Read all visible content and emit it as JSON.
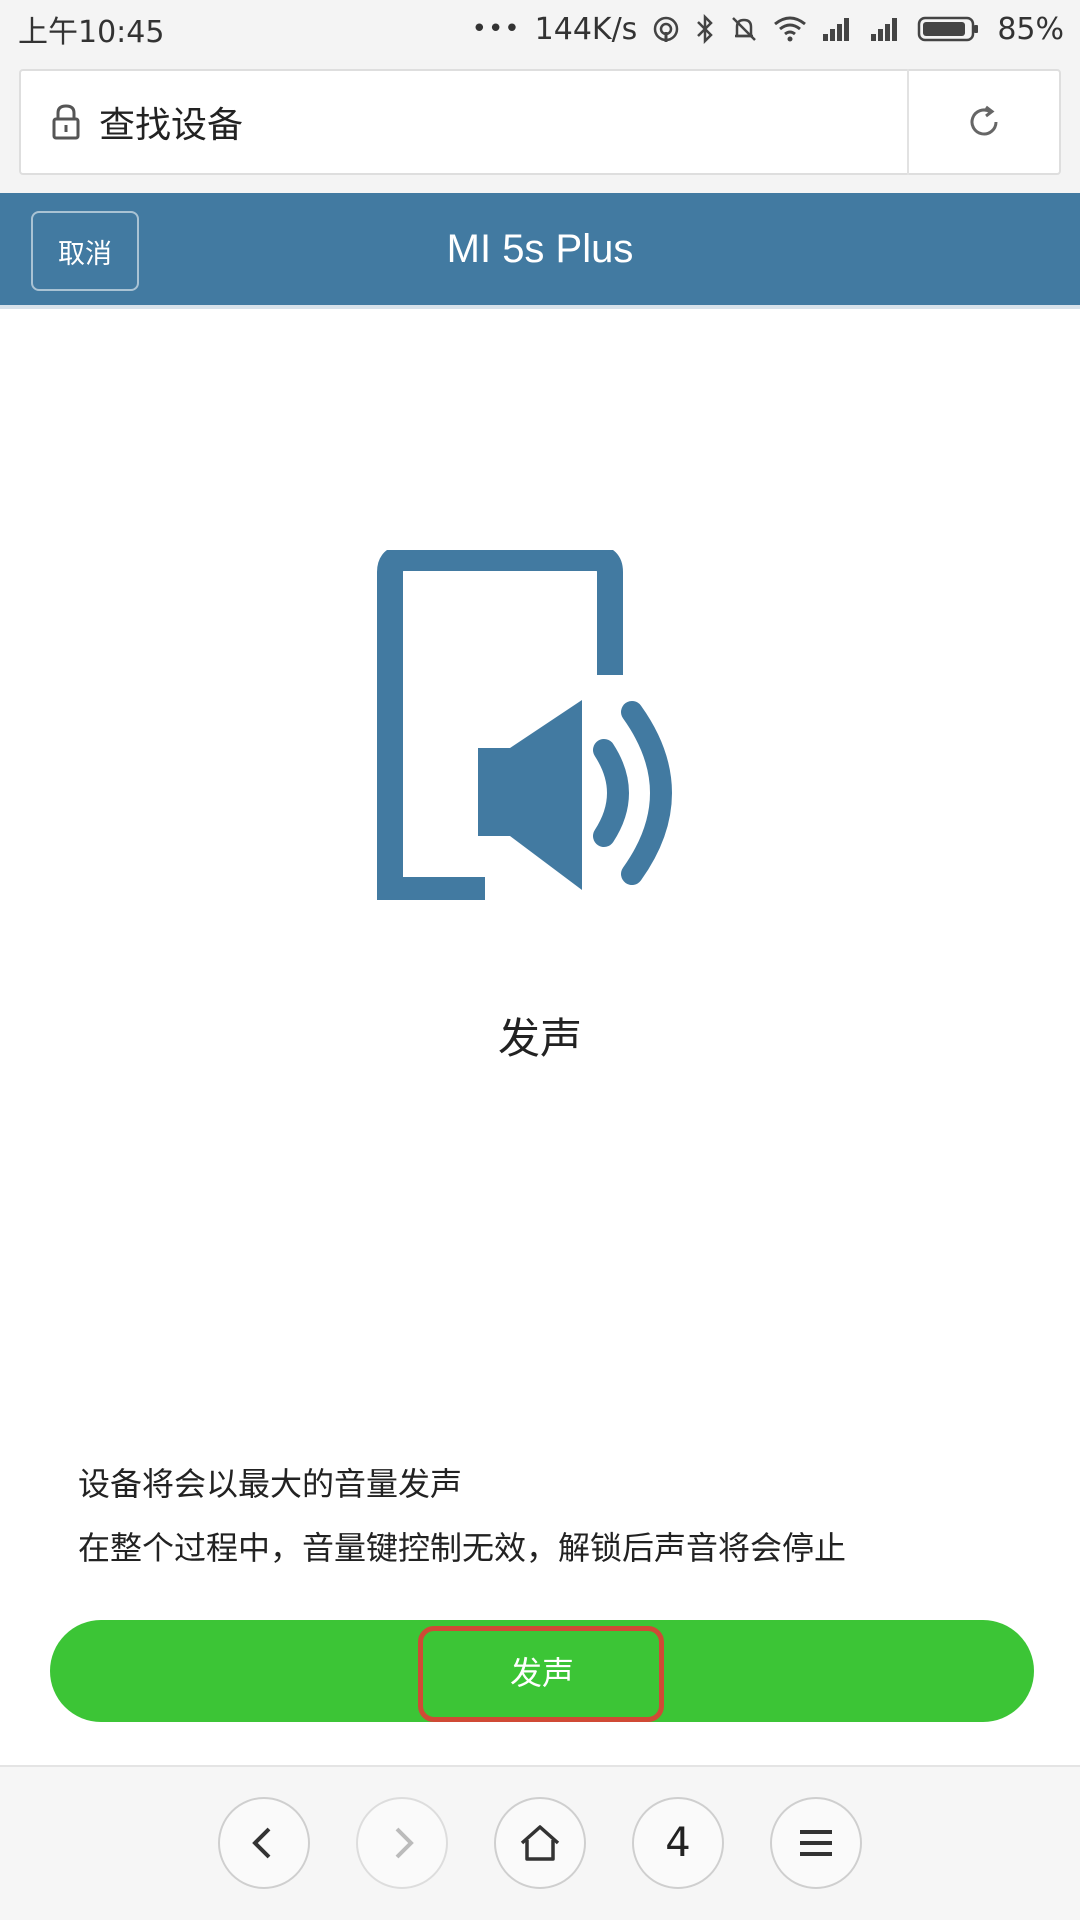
{
  "status_bar": {
    "time": "上午10:45",
    "dots": "•••",
    "net_speed": "144K/s",
    "battery_pct": "85%"
  },
  "address_bar": {
    "title": "查找设备"
  },
  "header": {
    "cancel_label": "取消",
    "device_name": "MI 5s Plus"
  },
  "main": {
    "feature_label": "发声",
    "description_line1": "设备将会以最大的音量发声",
    "description_line2": "在整个过程中，音量键控制无效，解锁后声音将会停止",
    "action_label": "发声"
  },
  "bottom_nav": {
    "tabs_count": "4"
  },
  "colors": {
    "header_bg": "#427aa1",
    "icon_blue": "#427aa1",
    "action_green": "#3cc536",
    "highlight_red": "#d04a35"
  },
  "icons": [
    "lock-icon",
    "refresh-icon",
    "phone-speaker-icon",
    "back-arrow-icon",
    "forward-arrow-icon",
    "home-icon",
    "menu-icon"
  ]
}
